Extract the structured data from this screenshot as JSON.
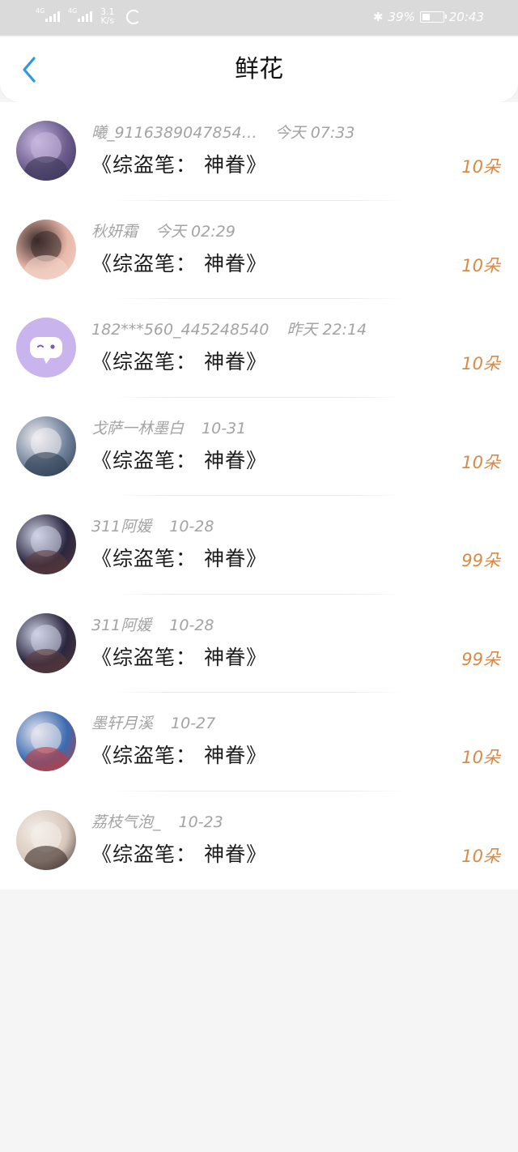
{
  "status_bar": {
    "sim1": "4G",
    "sim2": "4G",
    "speed_value": "3.1",
    "speed_unit": "K/s",
    "battery": "39%",
    "time": "20:43",
    "battery_level": 0.39,
    "icons": [
      "signal-icon",
      "loading-icon",
      "bluetooth-icon",
      "battery-icon"
    ]
  },
  "header": {
    "title": "鲜花",
    "back_icon": "chevron-left-icon",
    "accent": "#2f98e0"
  },
  "colors": {
    "meta_text": "#a3a3a3",
    "title_text": "#1c1c1c",
    "count_text": "#d98a45",
    "page_bg": "#f6f5f5"
  },
  "items": [
    {
      "name": "曦_9116389047854…",
      "time": "今天 07:33",
      "book": "《综盗笔： 神眷》",
      "count": "10朵",
      "avatar_colors": [
        "#6b5b8c",
        "#c8b8e0",
        "#3a3556"
      ]
    },
    {
      "name": "秋妍霜",
      "time": "今天 02:29",
      "book": "《综盗笔： 神眷》",
      "count": "10朵",
      "avatar_colors": [
        "#e9b8a8",
        "#3a2a2a",
        "#f2d6cc"
      ]
    },
    {
      "name": "182***560_445248540",
      "time": "昨天 22:14",
      "book": "《综盗笔： 神眷》",
      "count": "10朵",
      "avatar_colors": [
        "#c9b4ee",
        "#ffffff",
        "#7a5ab8"
      ]
    },
    {
      "name": "戈萨一林墨白",
      "time": "10-31",
      "book": "《综盗笔： 神眷》",
      "count": "10朵",
      "avatar_colors": [
        "#6f8199",
        "#f1eef2",
        "#2c3a4e"
      ]
    },
    {
      "name": "311阿媛",
      "time": "10-28",
      "book": "《综盗笔： 神眷》",
      "count": "99朵",
      "avatar_colors": [
        "#2a2640",
        "#cfd4e6",
        "#5a3a3a"
      ]
    },
    {
      "name": "311阿媛",
      "time": "10-28",
      "book": "《综盗笔： 神眷》",
      "count": "99朵",
      "avatar_colors": [
        "#2a2640",
        "#cfd4e6",
        "#5a3a3a"
      ]
    },
    {
      "name": "墨轩月溪",
      "time": "10-27",
      "book": "《综盗笔： 神眷》",
      "count": "10朵",
      "avatar_colors": [
        "#3b6bb0",
        "#e8e6ef",
        "#c23a3a"
      ]
    },
    {
      "name": "荔枝气泡_",
      "time": "10-23",
      "book": "《综盗笔： 神眷》",
      "count": "10朵",
      "avatar_colors": [
        "#d8c8bc",
        "#f4efe9",
        "#3a2d28"
      ]
    }
  ]
}
